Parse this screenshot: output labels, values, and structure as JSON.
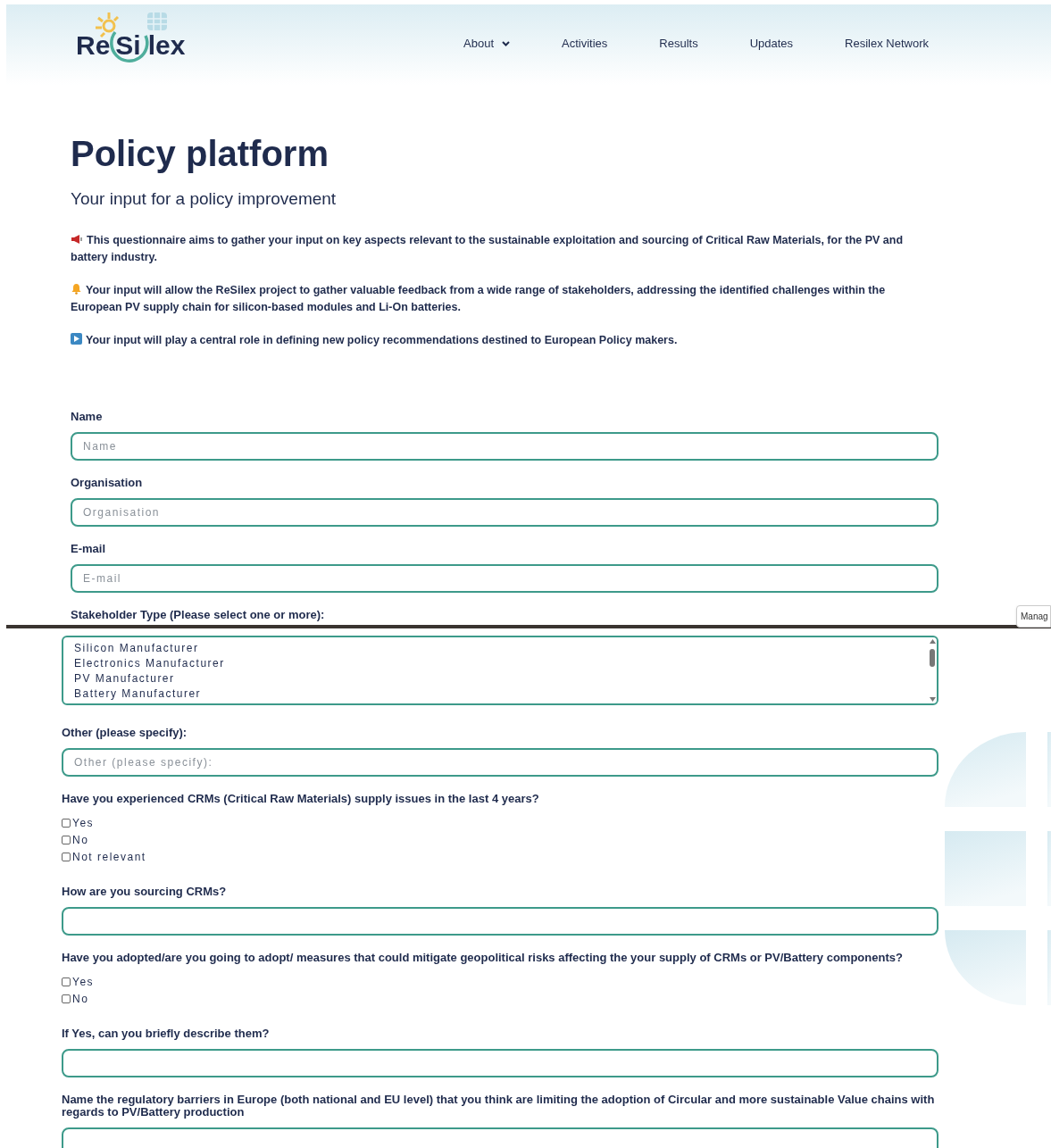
{
  "header": {
    "logo": [
      "Re",
      "Si",
      "lex"
    ],
    "nav": [
      {
        "label": "About",
        "dropdown": true
      },
      {
        "label": "Activities",
        "dropdown": false
      },
      {
        "label": "Results",
        "dropdown": false
      },
      {
        "label": "Updates",
        "dropdown": false
      },
      {
        "label": "Resilex Network",
        "dropdown": false
      }
    ]
  },
  "title": "Policy platform",
  "subtitle": "Your input for a policy improvement",
  "intro": [
    {
      "text": "This questionnaire aims to gather your input on key aspects relevant to the sustainable exploitation and sourcing of Critical Raw Materials, for the PV and battery industry."
    },
    {
      "text": "Your input will allow the ReSilex project to gather valuable feedback from a wide range of stakeholders, addressing the identified challenges within the European PV supply chain for silicon-based modules and Li-On batteries."
    },
    {
      "text": "Your input will play a central role in defining new policy recommendations destined to European Policy makers."
    }
  ],
  "form_top": [
    {
      "kind": "text",
      "label": "Name",
      "placeholder": "Name"
    },
    {
      "kind": "text",
      "label": "Organisation",
      "placeholder": "Organisation"
    },
    {
      "kind": "text",
      "label": "E-mail",
      "placeholder": "E-mail"
    },
    {
      "kind": "label",
      "label": "Stakeholder Type (Please select one or more):"
    }
  ],
  "side_button": "Manag",
  "form_bottom": [
    {
      "kind": "listbox",
      "options": [
        "Silicon Manufacturer",
        "Electronics Manufacturer",
        "PV Manufacturer",
        "Battery Manufacturer"
      ]
    },
    {
      "kind": "text",
      "label": "Other (please specify):",
      "placeholder": "Other (please specify):"
    },
    {
      "kind": "checks",
      "label": "Have you experienced CRMs (Critical Raw Materials) supply issues in the last 4 years?",
      "options": [
        {
          "label": "Yes",
          "checked": false
        },
        {
          "label": "No",
          "checked": false
        },
        {
          "label": "Not relevant",
          "checked": false
        }
      ]
    },
    {
      "kind": "text",
      "label": "How are you sourcing CRMs?"
    },
    {
      "kind": "checks",
      "label": "Have you adopted/are you going to adopt/ measures that could mitigate geopolitical risks affecting the your supply of CRMs or PV/Battery components?",
      "options": [
        {
          "label": "Yes",
          "checked": false
        },
        {
          "label": "No",
          "checked": false
        }
      ]
    },
    {
      "kind": "text",
      "label": "If Yes, can you briefly describe them?"
    },
    {
      "kind": "text",
      "label": "Name the regulatory barriers in Europe (both national and EU level) that you think are limiting the adoption of Circular and more sustainable Value chains with regards to PV/Battery production"
    }
  ]
}
